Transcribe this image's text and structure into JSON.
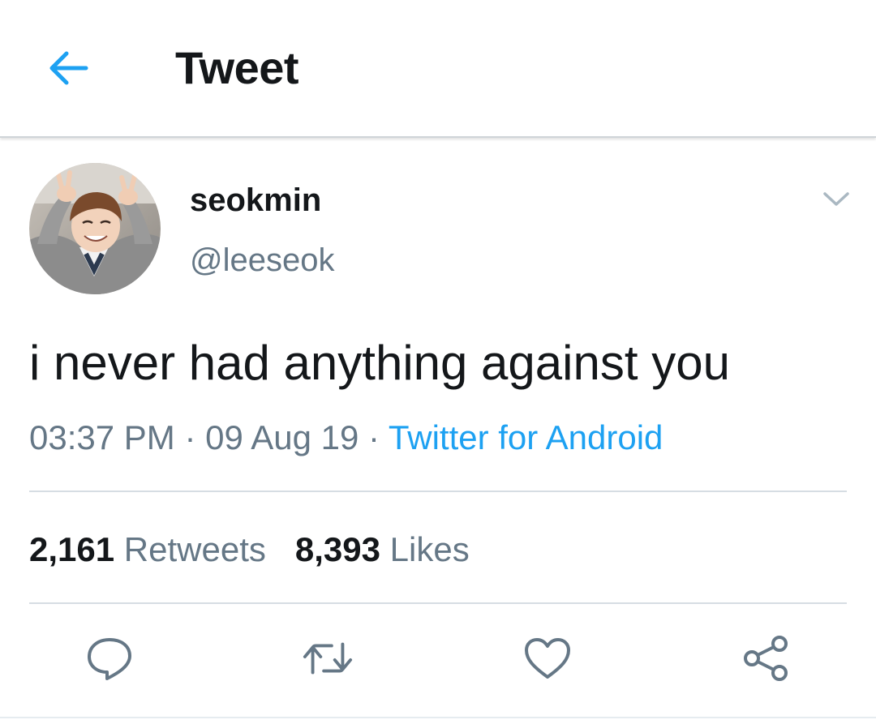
{
  "header": {
    "title": "Tweet",
    "back_icon": "arrow-left-icon"
  },
  "tweet": {
    "author": {
      "display_name": "seokmin",
      "handle": "@leeseok",
      "avatar": "profile-photo"
    },
    "more_icon": "chevron-down-icon",
    "text": "i never had anything against you",
    "time": "03:37 PM",
    "separator": "·",
    "date": "09 Aug 19",
    "source": "Twitter for Android",
    "stats": {
      "retweets_count": "2,161",
      "retweets_label": "Retweets",
      "likes_count": "8,393",
      "likes_label": "Likes"
    },
    "actions": [
      {
        "name": "reply",
        "icon": "speech-bubble-icon"
      },
      {
        "name": "retweet",
        "icon": "retweet-icon"
      },
      {
        "name": "like",
        "icon": "heart-icon"
      },
      {
        "name": "share",
        "icon": "share-icon"
      }
    ]
  },
  "colors": {
    "accent": "#1da1f2",
    "text_primary": "#14171a",
    "text_secondary": "#657786",
    "divider": "#d6dde3"
  }
}
